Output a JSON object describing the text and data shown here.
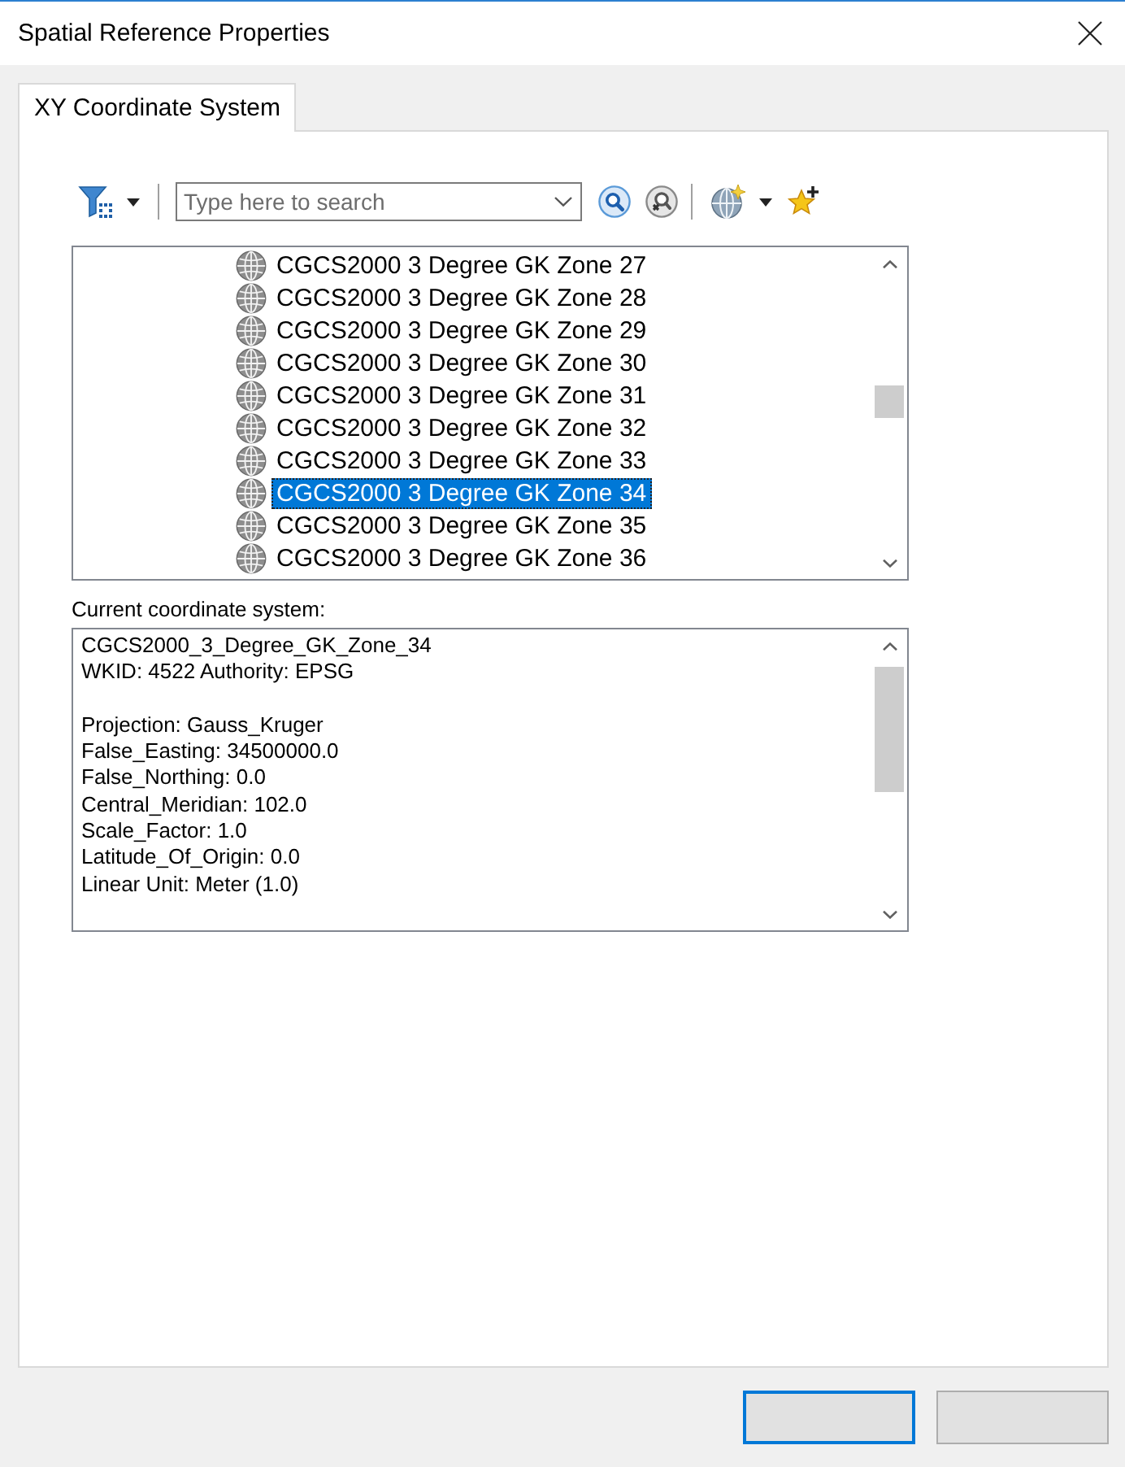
{
  "window": {
    "title": "Spatial Reference Properties"
  },
  "tabs": [
    {
      "label": "XY Coordinate System",
      "selected": true
    }
  ],
  "toolbar": {
    "search": {
      "placeholder": "Type here to search"
    }
  },
  "list": {
    "items": [
      {
        "label": "CGCS2000 3 Degree GK Zone 27",
        "selected": false
      },
      {
        "label": "CGCS2000 3 Degree GK Zone 28",
        "selected": false
      },
      {
        "label": "CGCS2000 3 Degree GK Zone 29",
        "selected": false
      },
      {
        "label": "CGCS2000 3 Degree GK Zone 30",
        "selected": false
      },
      {
        "label": "CGCS2000 3 Degree GK Zone 31",
        "selected": false
      },
      {
        "label": "CGCS2000 3 Degree GK Zone 32",
        "selected": false
      },
      {
        "label": "CGCS2000 3 Degree GK Zone 33",
        "selected": false
      },
      {
        "label": "CGCS2000 3 Degree GK Zone 34",
        "selected": true
      },
      {
        "label": "CGCS2000 3 Degree GK Zone 35",
        "selected": false
      },
      {
        "label": "CGCS2000 3 Degree GK Zone 36",
        "selected": false
      }
    ]
  },
  "details": {
    "label": "Current coordinate system:",
    "paragraphs": [
      [
        "CGCS2000_3_Degree_GK_Zone_34",
        "WKID: 4522 Authority: EPSG"
      ],
      [
        "Projection: Gauss_Kruger",
        "False_Easting: 34500000.0",
        "False_Northing: 0.0",
        "Central_Meridian: 102.0",
        "Scale_Factor: 1.0",
        "Latitude_Of_Origin: 0.0",
        "Linear Unit: Meter (1.0)"
      ]
    ]
  },
  "buttons": [
    {
      "focused": true
    },
    {
      "focused": false
    }
  ]
}
